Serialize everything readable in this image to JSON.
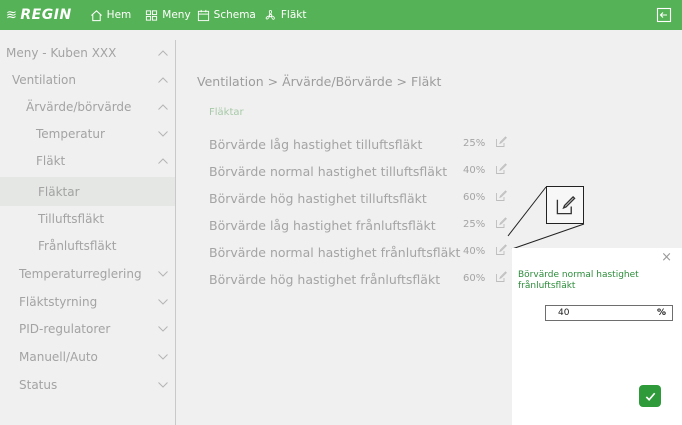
{
  "topbar": {
    "logo": "REGIN",
    "nav": [
      {
        "id": "home",
        "label": "Hem",
        "icon": "home-icon"
      },
      {
        "id": "menu",
        "label": "Meny",
        "icon": "grid-icon"
      },
      {
        "id": "schema",
        "label": "Schema",
        "icon": "calendar-icon"
      },
      {
        "id": "flakt",
        "label": "Fläkt",
        "icon": "fan-icon"
      }
    ],
    "colors": {
      "bar": "#56b257",
      "accent": "#2e9a3a"
    }
  },
  "sidebar": {
    "items": [
      {
        "label": "Meny - Kuben XXX",
        "chevron": "up"
      },
      {
        "label": "Ventilation",
        "chevron": "up"
      },
      {
        "label": "Ärvärde/börvärde",
        "chevron": "up"
      },
      {
        "label": "Temperatur",
        "chevron": "down"
      },
      {
        "label": "Fläkt",
        "chevron": "up"
      },
      {
        "label": "Fläktar",
        "chevron": "none",
        "active": true
      },
      {
        "label": "Tilluftsfläkt",
        "chevron": "none"
      },
      {
        "label": "Frånluftsfläkt",
        "chevron": "none"
      },
      {
        "label": "Temperaturreglering",
        "chevron": "down"
      },
      {
        "label": "Fläktstyrning",
        "chevron": "down"
      },
      {
        "label": "PID-regulatorer",
        "chevron": "down"
      },
      {
        "label": "Manuell/Auto",
        "chevron": "down"
      },
      {
        "label": "Status",
        "chevron": "down"
      }
    ]
  },
  "main": {
    "breadcrumb": "Ventilation > Ärvärde/Börvärde > Fläkt",
    "section": "Fläktar",
    "rows": [
      {
        "label": "Börvärde låg hastighet tilluftsfläkt",
        "value": "25%"
      },
      {
        "label": "Börvärde normal hastighet tilluftsfläkt",
        "value": "40%"
      },
      {
        "label": "Börvärde hög hastighet tilluftsfläkt",
        "value": "60%"
      },
      {
        "label": "Börvärde låg hastighet frånluftsfläkt",
        "value": "25%"
      },
      {
        "label": "Börvärde normal hastighet frånluftsfläkt",
        "value": "40%"
      },
      {
        "label": "Börvärde hög hastighet frånluftsfläkt",
        "value": "60%"
      }
    ]
  },
  "dialog": {
    "close": "×",
    "title": "Börvärde normal hastighet frånluftsfläkt",
    "value": "40",
    "unit": "%"
  }
}
